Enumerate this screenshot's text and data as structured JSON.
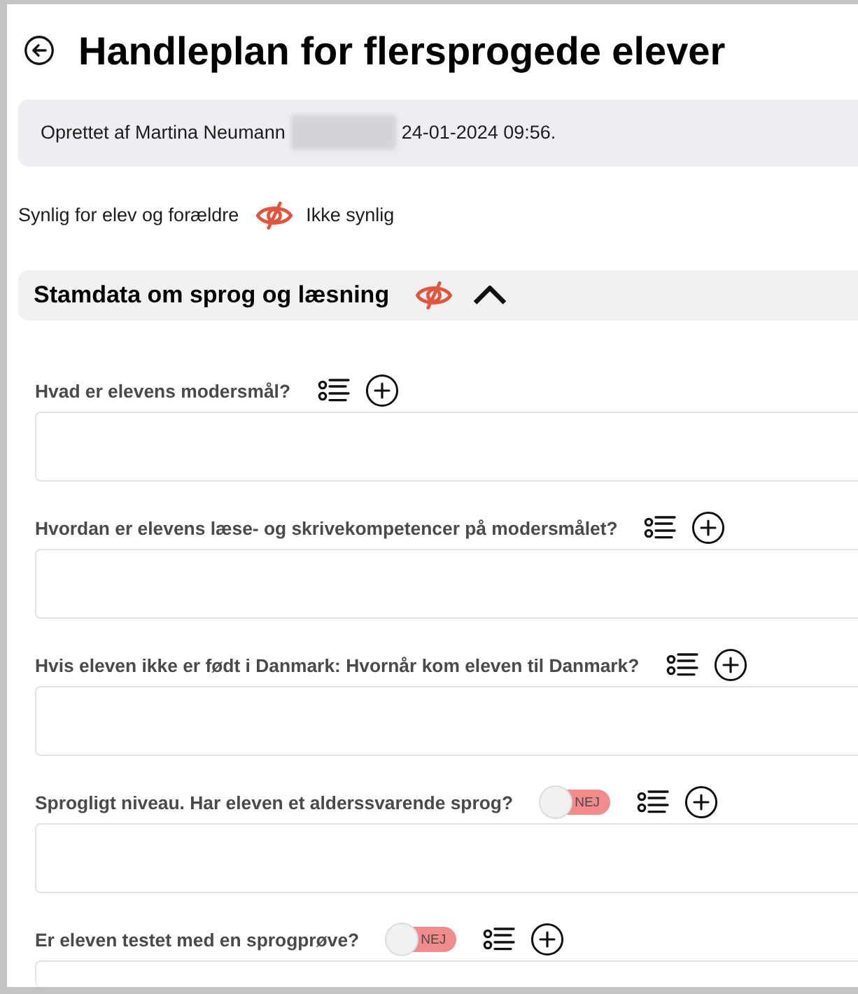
{
  "page": {
    "title": "Handleplan for flersprogede elever"
  },
  "info": {
    "created_by": "Oprettet af Martina Neumann",
    "redacted": true,
    "created_at": "24-01-2024 09:56."
  },
  "visibility": {
    "label": "Synlig for elev og forældre",
    "visible": false,
    "status": "Ikke synlig"
  },
  "section": {
    "title": "Stamdata om sprog og læsning",
    "visible": false,
    "expanded": true,
    "questions": [
      {
        "label": "Hvad er elevens modersmål?"
      },
      {
        "label": "Hvordan er elevens læse- og skrivekompetencer på modersmålet?"
      },
      {
        "label": "Hvis eleven ikke er født i Danmark: Hvornår kom eleven til Danmark?"
      },
      {
        "label": "Sprogligt niveau. Har eleven et alderssvarende sprog?",
        "toggle": {
          "on": false,
          "label": "NEJ"
        }
      },
      {
        "label": "Er eleven testet med en sprogprøve?",
        "toggle": {
          "on": false,
          "label": "NEJ"
        }
      }
    ]
  }
}
